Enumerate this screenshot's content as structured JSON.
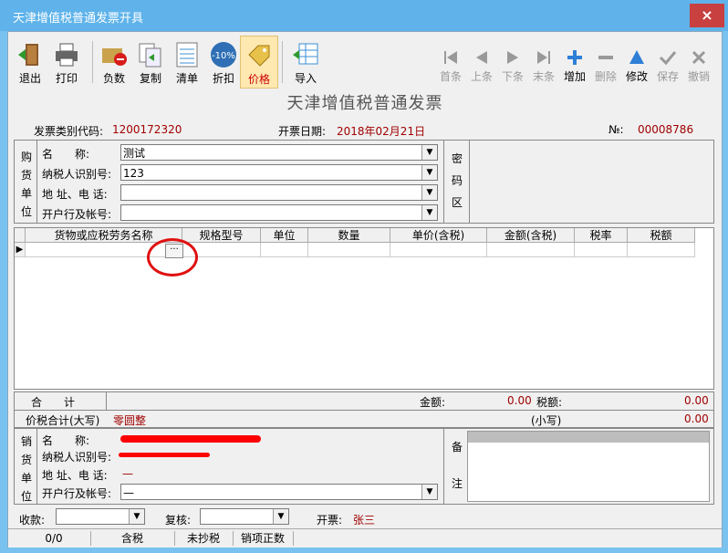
{
  "window": {
    "title": "天津增值税普通发票开具",
    "close": "×"
  },
  "toolbar": {
    "left": [
      {
        "label": "退出",
        "icon": "exit-door-icon"
      },
      {
        "label": "打印",
        "icon": "printer-icon"
      },
      {
        "label": "负数",
        "icon": "negative-folder-icon"
      },
      {
        "label": "复制",
        "icon": "copy-document-icon"
      },
      {
        "label": "清单",
        "icon": "list-sheet-icon"
      },
      {
        "label": "折扣",
        "icon": "discount-badge-icon",
        "badge": "-10%"
      },
      {
        "label": "价格",
        "icon": "price-tag-icon"
      },
      {
        "label": "导入",
        "icon": "import-table-icon"
      }
    ],
    "right": [
      {
        "label": "首条",
        "icon": "first-record-icon"
      },
      {
        "label": "上条",
        "icon": "previous-record-icon"
      },
      {
        "label": "下条",
        "icon": "next-record-icon"
      },
      {
        "label": "末条",
        "icon": "last-record-icon"
      },
      {
        "label": "增加",
        "icon": "add-plus-icon"
      },
      {
        "label": "删除",
        "icon": "delete-minus-icon"
      },
      {
        "label": "修改",
        "icon": "edit-triangle-icon"
      },
      {
        "label": "保存",
        "icon": "save-check-icon"
      },
      {
        "label": "撤销",
        "icon": "cancel-x-icon"
      }
    ]
  },
  "invoice": {
    "title": "天津增值税普通发票",
    "type_code_label": "发票类别代码:",
    "type_code": "1200172320",
    "date_label": "开票日期:",
    "date": "2018年02月21日",
    "number_label": "№:",
    "number": "00008786"
  },
  "buyer": {
    "section": [
      "购",
      "货",
      "单",
      "位"
    ],
    "name_label": "名　　称:",
    "name": "测试",
    "tax_id_label": "纳税人识别号:",
    "tax_id": "123",
    "address_label": "地 址、电 话:",
    "address": "",
    "bank_label": "开户行及帐号:",
    "bank": ""
  },
  "cipher": [
    "密",
    "码",
    "区"
  ],
  "items_table": {
    "columns": [
      "货物或应税劳务名称",
      "规格型号",
      "单位",
      "数量",
      "单价(含税)",
      "金额(含税)",
      "税率",
      "税额"
    ],
    "row_marker": "▶",
    "ellipsis": "···"
  },
  "totals": {
    "sum_label": "合　　计",
    "amount_label": "金额:",
    "amount": "0.00",
    "tax_label": "税额:",
    "tax": "0.00",
    "total_label": "价税合计(大写)",
    "total_upper": "零圆整",
    "small_label": "(小写)",
    "total_small": "0.00"
  },
  "seller": {
    "section": [
      "销",
      "货",
      "单",
      "位"
    ],
    "name_label": "名　　称:",
    "tax_id_label": "纳税人识别号:",
    "address_label": "地 址、电 话:",
    "address": "—",
    "bank_label": "开户行及帐号:",
    "bank": "—"
  },
  "remarks": [
    "备",
    "注"
  ],
  "footer": {
    "payee_label": "收款:",
    "reviewer_label": "复核:",
    "issuer_label": "开票:",
    "issuer": "张三"
  },
  "status": [
    "0/0",
    "含税",
    "未抄税",
    "销项正数"
  ]
}
